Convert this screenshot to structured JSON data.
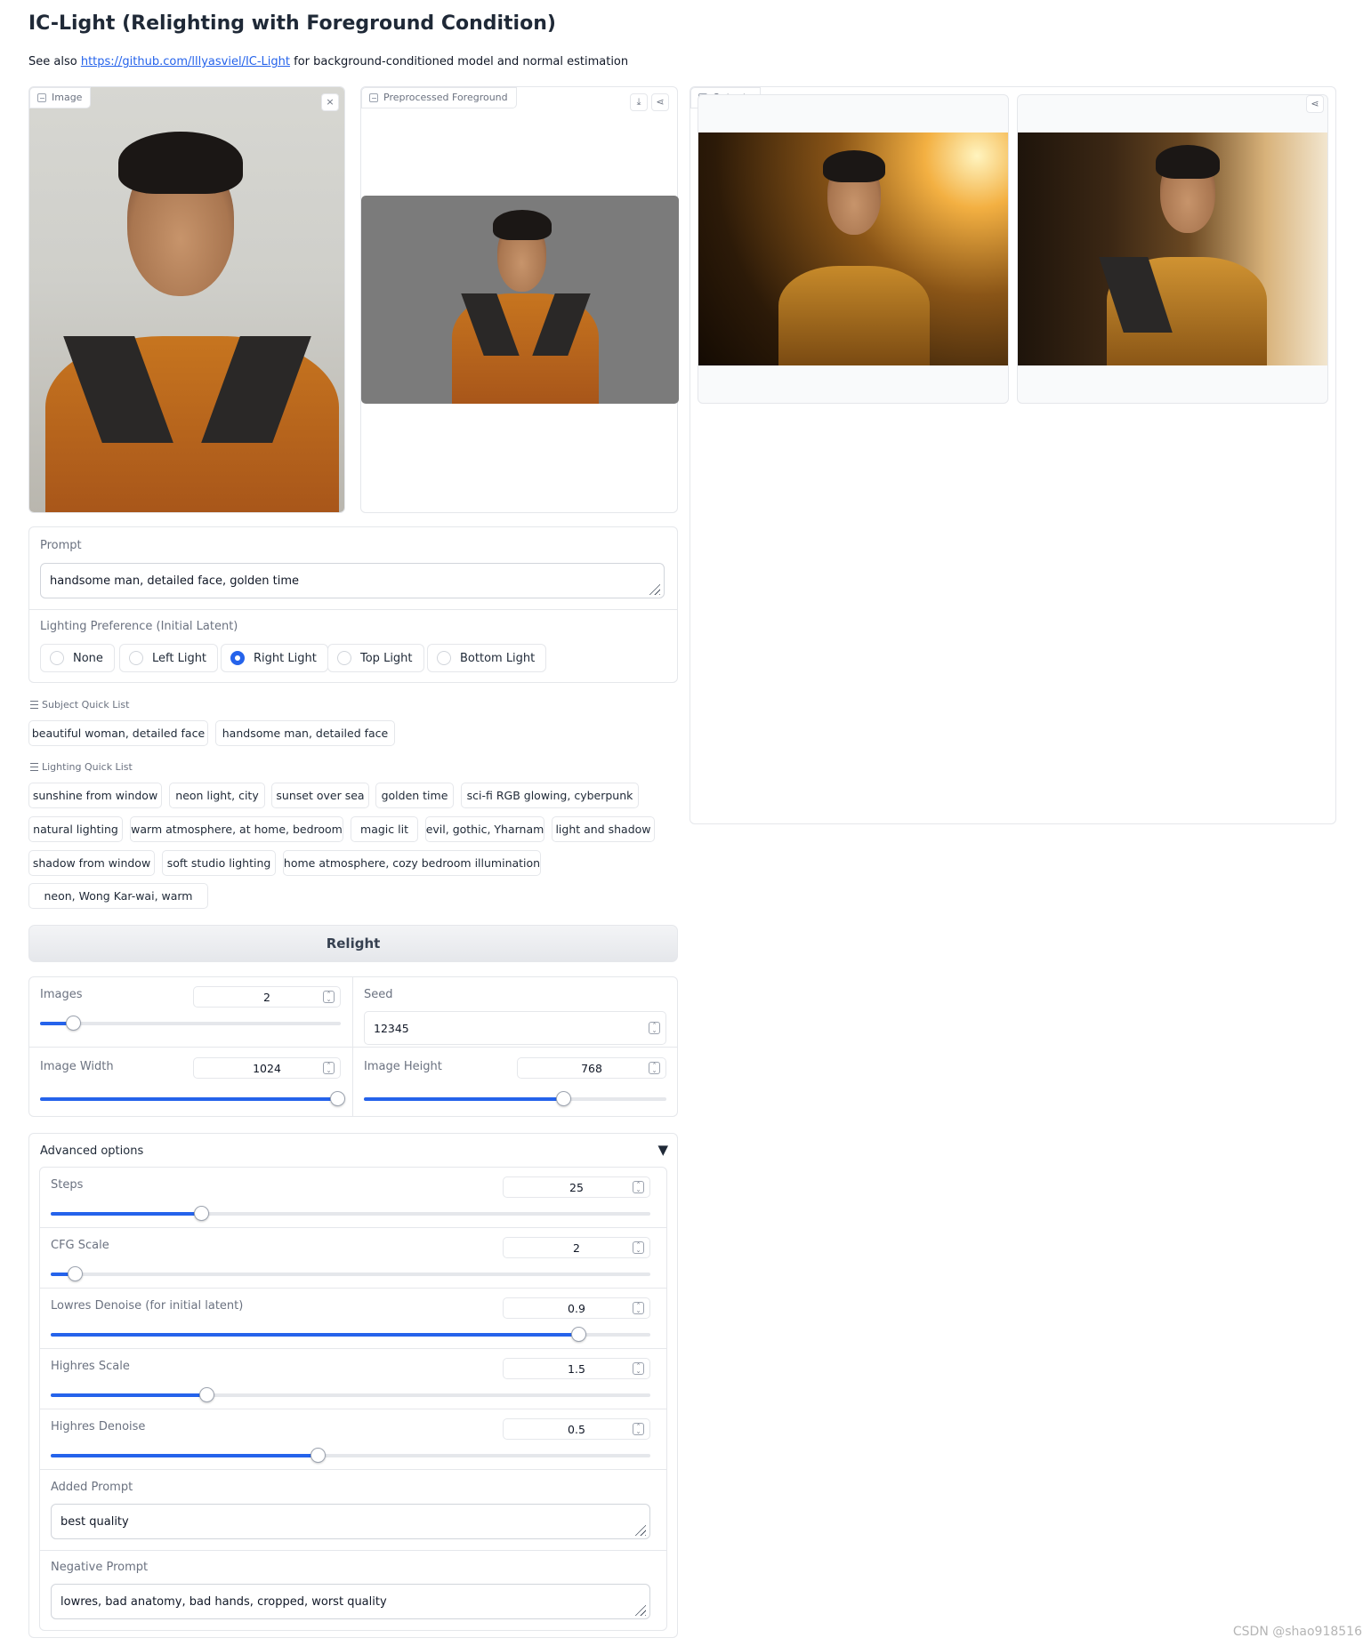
{
  "header": {
    "title": "IC-Light (Relighting with Foreground Condition)",
    "see_also_prefix": "See also ",
    "link_text": "https://github.com/lllyasviel/IC-Light",
    "see_also_suffix": " for background-conditioned model and normal estimation"
  },
  "image_panel": {
    "label": "Image",
    "close_icon": "×"
  },
  "preprocessed_panel": {
    "label": "Preprocessed Foreground",
    "download_icon": "⤓",
    "share_icon": "⋖"
  },
  "outputs_panel": {
    "label": "Outputs",
    "share_icon": "⋖"
  },
  "prompt": {
    "label": "Prompt",
    "value": "handsome man, detailed face, golden time"
  },
  "lighting": {
    "label": "Lighting Preference (Initial Latent)",
    "options": [
      "None",
      "Left Light",
      "Right Light",
      "Top Light",
      "Bottom Light"
    ],
    "selected": "Right Light"
  },
  "subject_quick_list": {
    "label": "Subject Quick List",
    "items": [
      "beautiful woman, detailed face",
      "handsome man, detailed face"
    ]
  },
  "lighting_quick_list": {
    "label": "Lighting Quick List",
    "items": [
      "sunshine from window",
      "neon light, city",
      "sunset over sea",
      "golden time",
      "sci-fi RGB glowing, cyberpunk",
      "natural lighting",
      "warm atmosphere, at home, bedroom",
      "magic lit",
      "evil, gothic, Yharnam",
      "light and shadow",
      "shadow from window",
      "soft studio lighting",
      "home atmosphere, cozy bedroom illumination",
      "neon, Wong Kar-wai, warm"
    ]
  },
  "relight_button": "Relight",
  "params": {
    "images": {
      "label": "Images",
      "value": "2",
      "fraction": 0.11
    },
    "seed": {
      "label": "Seed",
      "value": "12345"
    },
    "width": {
      "label": "Image Width",
      "value": "1024",
      "fraction": 1.0
    },
    "height": {
      "label": "Image Height",
      "value": "768",
      "fraction": 0.66
    }
  },
  "advanced": {
    "label": "Advanced options",
    "toggle_icon": "▼",
    "steps": {
      "label": "Steps",
      "value": "25",
      "fraction": 0.25
    },
    "cfg": {
      "label": "CFG Scale",
      "value": "2",
      "fraction": 0.04
    },
    "lowres_denoise": {
      "label": "Lowres Denoise (for initial latent)",
      "value": "0.9",
      "fraction": 0.88
    },
    "highres_scale": {
      "label": "Highres Scale",
      "value": "1.5",
      "fraction": 0.26
    },
    "highres_denoise": {
      "label": "Highres Denoise",
      "value": "0.5",
      "fraction": 0.445
    },
    "added_prompt": {
      "label": "Added Prompt",
      "value": "best quality"
    },
    "negative_prompt": {
      "label": "Negative Prompt",
      "value": "lowres, bad anatomy, bad hands, cropped, worst quality"
    }
  },
  "watermark": "CSDN @shao918516",
  "colors": {
    "accent": "#2563eb",
    "border": "#e5e7eb"
  },
  "spin_icon": "⌃⌄"
}
